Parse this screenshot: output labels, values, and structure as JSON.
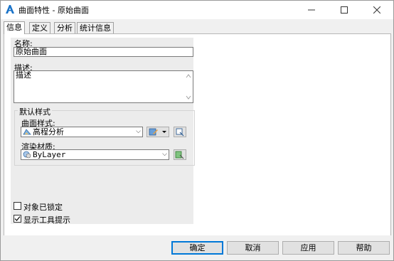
{
  "window": {
    "title": "曲面特性 - 原始曲面"
  },
  "tabs": [
    {
      "label": "信息"
    },
    {
      "label": "定义"
    },
    {
      "label": "分析"
    },
    {
      "label": "统计信息"
    }
  ],
  "info": {
    "name_label": "名称:",
    "name_value": "原始曲面",
    "desc_label": "描述:",
    "desc_value": "描述",
    "default_styles_label": "默认样式",
    "surface_style_label": "曲面样式:",
    "surface_style_value": "高程分析",
    "render_material_label": "渲染材质:",
    "render_material_value": "ByLayer",
    "object_locked_label": "对象已锁定",
    "object_locked_checked": false,
    "show_tooltips_label": "显示工具提示",
    "show_tooltips_checked": true
  },
  "buttons": {
    "ok": "确定",
    "cancel": "取消",
    "apply": "应用",
    "help": "帮助"
  },
  "icons": {
    "app": "autocad-civil-icon",
    "minimize": "minimize-icon",
    "maximize": "maximize-icon",
    "close": "close-icon"
  },
  "colors": {
    "accent": "#0078d7",
    "app_icon": "#1a73c8"
  }
}
